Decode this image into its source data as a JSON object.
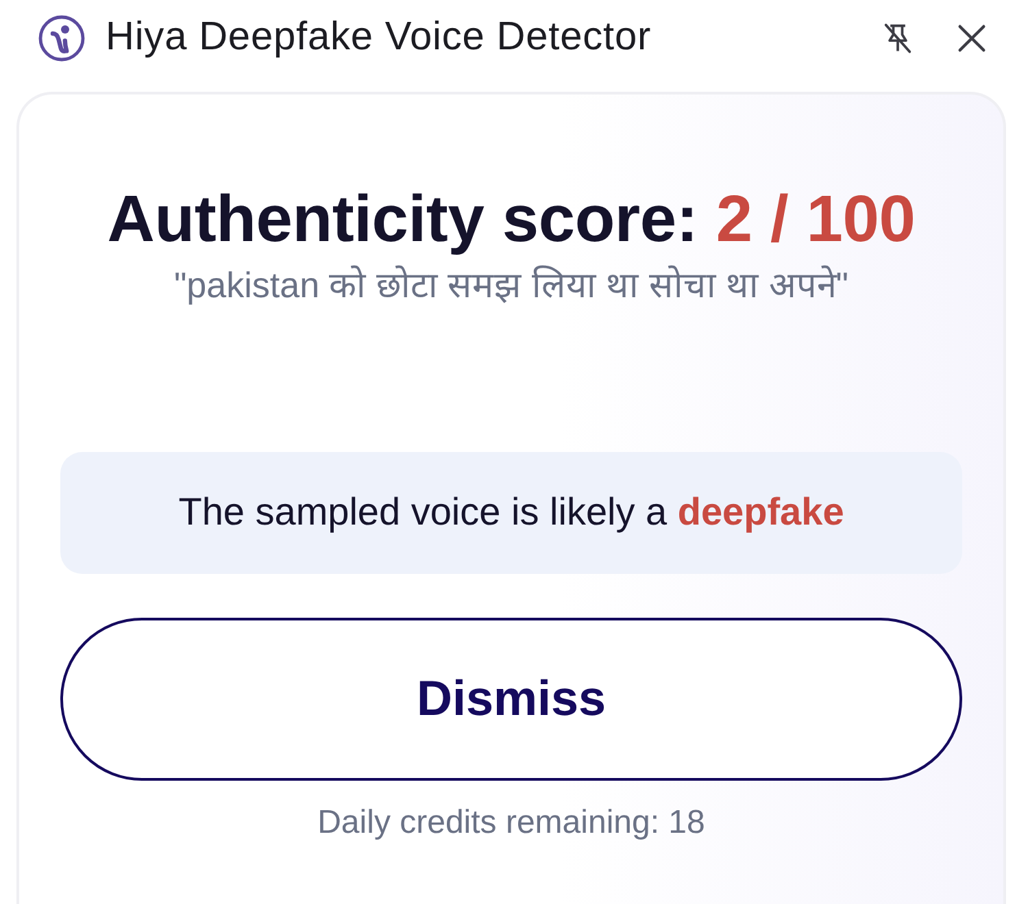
{
  "window": {
    "title": "Hiya Deepfake Voice Detector"
  },
  "result": {
    "heading": "Authenticity score:",
    "score": "2 / 100",
    "quote": "\"pakistan को छोटा समझ लिया था सोचा था अपने\"",
    "verdict": "The sampled voice is likely a **deepfake**"
  },
  "actions": {
    "dismiss": "Dismiss"
  },
  "footer": {
    "credits": "Daily credits remaining: 18"
  }
}
